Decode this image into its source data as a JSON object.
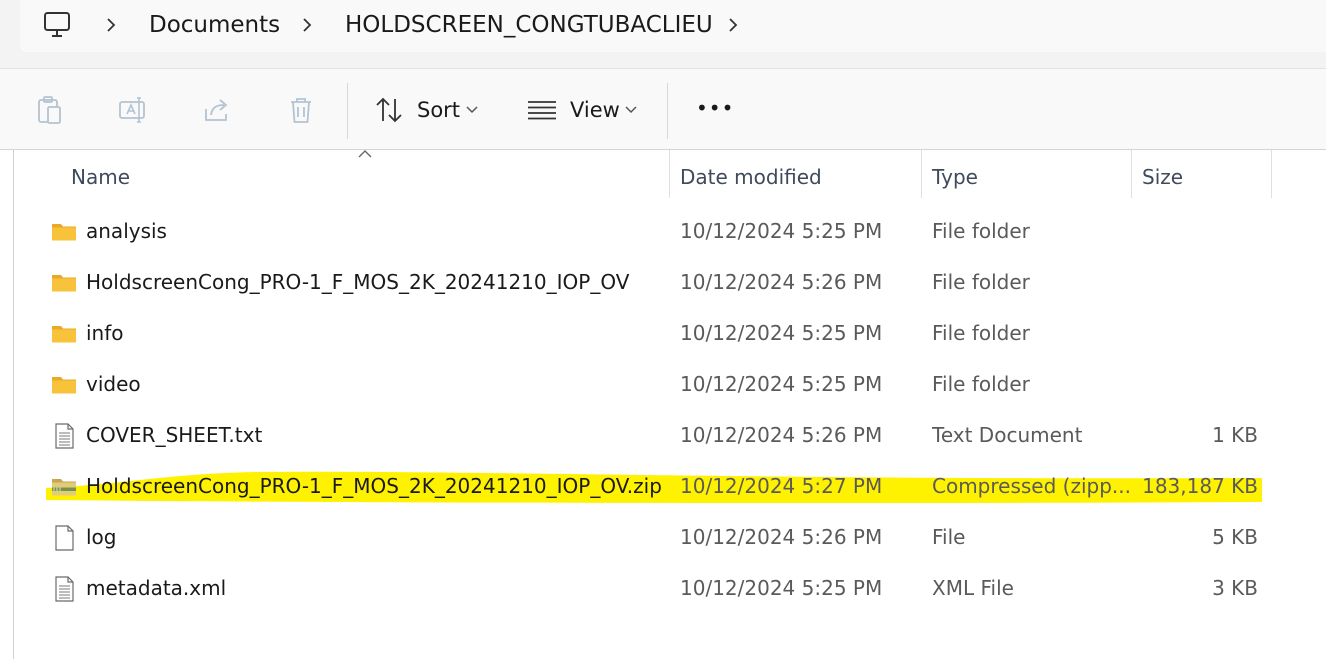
{
  "breadcrumb": {
    "items": [
      "Documents",
      "HOLDSCREEN_CONGTUBACLIEU"
    ]
  },
  "commandbar": {
    "sort_label": "Sort",
    "view_label": "View",
    "more_label": "•••"
  },
  "columns": {
    "name": "Name",
    "date": "Date modified",
    "type": "Type",
    "size": "Size"
  },
  "files": [
    {
      "name": "analysis",
      "date": "10/12/2024 5:25 PM",
      "type": "File folder",
      "size": "",
      "icon": "folder-icon"
    },
    {
      "name": "HoldscreenCong_PRO-1_F_MOS_2K_20241210_IOP_OV",
      "date": "10/12/2024 5:26 PM",
      "type": "File folder",
      "size": "",
      "icon": "folder-icon"
    },
    {
      "name": "info",
      "date": "10/12/2024 5:25 PM",
      "type": "File folder",
      "size": "",
      "icon": "folder-icon"
    },
    {
      "name": "video",
      "date": "10/12/2024 5:25 PM",
      "type": "File folder",
      "size": "",
      "icon": "folder-icon"
    },
    {
      "name": "COVER_SHEET.txt",
      "date": "10/12/2024 5:26 PM",
      "type": "Text Document",
      "size": "1 KB",
      "icon": "text-file-icon"
    },
    {
      "name": "HoldscreenCong_PRO-1_F_MOS_2K_20241210_IOP_OV.zip",
      "date": "10/12/2024 5:27 PM",
      "type": "Compressed (zipp...",
      "size": "183,187 KB",
      "icon": "zip-folder-icon",
      "highlighted": true
    },
    {
      "name": "log",
      "date": "10/12/2024 5:26 PM",
      "type": "File",
      "size": "5 KB",
      "icon": "blank-file-icon"
    },
    {
      "name": "metadata.xml",
      "date": "10/12/2024 5:25 PM",
      "type": "XML File",
      "size": "3 KB",
      "icon": "text-file-icon"
    }
  ],
  "colors": {
    "highlight": "#fff200",
    "folder": "#f8c33a",
    "folder_back": "#e9a92a"
  }
}
